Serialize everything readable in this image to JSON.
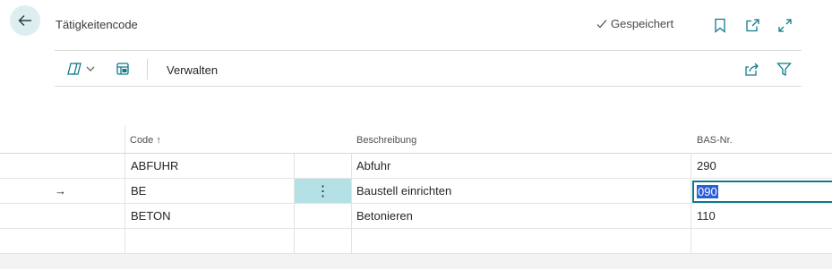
{
  "header": {
    "title": "Tätigkeitencode",
    "status": "Gespeichert"
  },
  "toolbar": {
    "manage_label": "Verwalten"
  },
  "table": {
    "columns": [
      "Code",
      "Beschreibung",
      "BAS-Nr."
    ],
    "code_sort_indicator": "↑",
    "rows": [
      {
        "code": "ABFUHR",
        "beschreibung": "Abfuhr",
        "bas_nr": "290"
      },
      {
        "code": "BE",
        "beschreibung": "Baustell einrichten",
        "bas_nr": "090"
      },
      {
        "code": "BETON",
        "beschreibung": "Betonieren",
        "bas_nr": "110"
      }
    ],
    "current_row_marker": "→",
    "row_actions_glyph": "⋮"
  },
  "colors": {
    "accent": "#0f7b8a",
    "selected_action_cell": "#b3e1e6",
    "text_selection": "#2b5ed8"
  },
  "icons": [
    "back-arrow-icon",
    "checkmark-icon",
    "bookmark-icon",
    "open-new-window-icon",
    "expand-icon",
    "copilot-icon",
    "chevron-down-icon",
    "page-layout-icon",
    "share-icon",
    "filter-icon"
  ]
}
